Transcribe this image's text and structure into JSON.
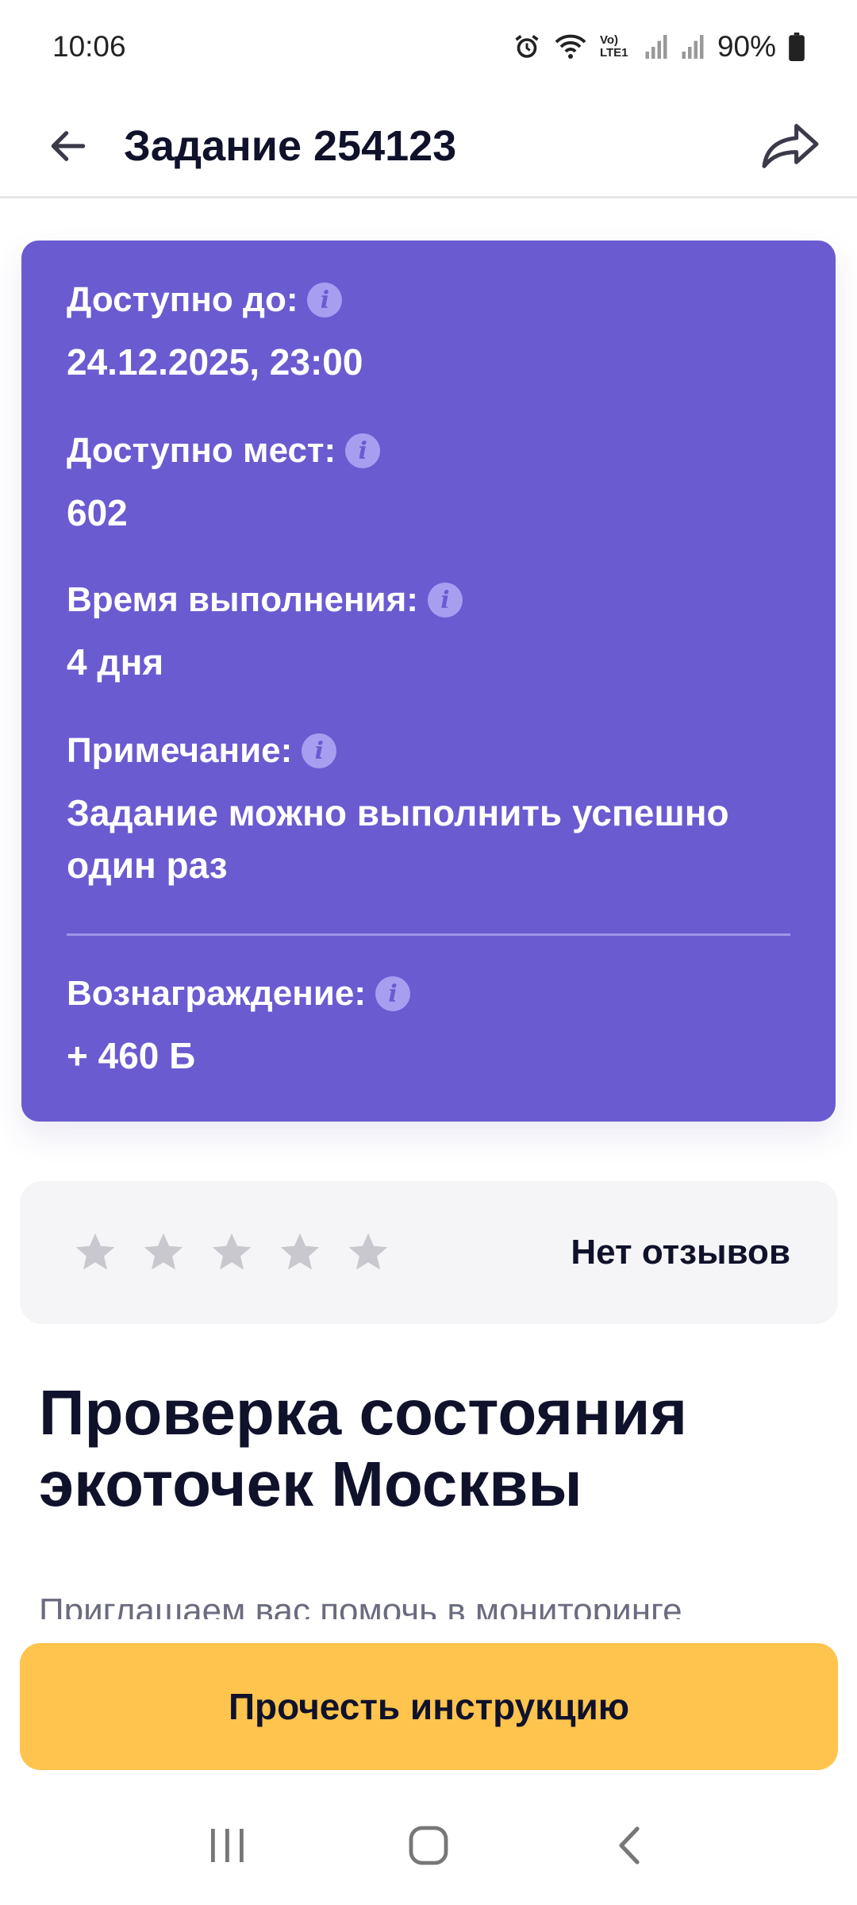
{
  "status_bar": {
    "time": "10:06",
    "network_label": "Vo) LTE1",
    "battery": "90%"
  },
  "app_bar": {
    "title": "Задание 254123",
    "back_icon": "arrow-left-icon",
    "share_icon": "share-arrow-icon"
  },
  "info": {
    "available_until_label": "Доступно до:",
    "available_until_value": "24.12.2025, 23:00",
    "places_label": "Доступно мест:",
    "places_value": "602",
    "duration_label": "Время выполнения:",
    "duration_value": "4 дня",
    "note_label": "Примечание:",
    "note_value": "Задание можно выполнить успешно один раз",
    "reward_label": "Вознаграждение:",
    "reward_value": "+ 460 Б",
    "info_icon_glyph": "i"
  },
  "reviews": {
    "rating": 0,
    "max": 5,
    "text": "Нет отзывов"
  },
  "task": {
    "title": "Проверка состояния экоточек Москвы",
    "description": "Приглашаем вас помочь в мониторинге"
  },
  "cta": {
    "label": "Прочесть инструкцию"
  },
  "colors": {
    "card": "#6a5bd1",
    "cta": "#ffc44d",
    "star_empty": "#c8c8ce"
  }
}
